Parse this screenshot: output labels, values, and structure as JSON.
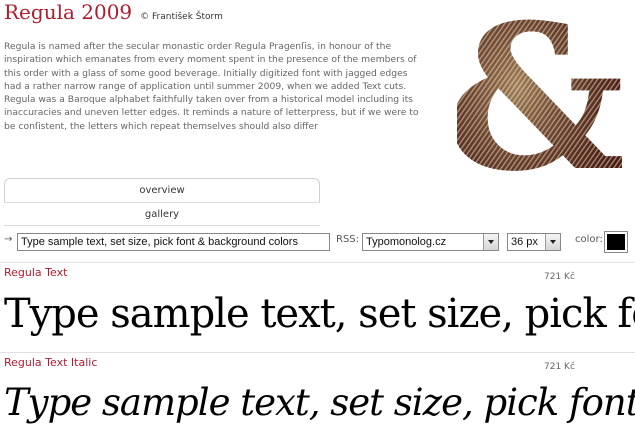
{
  "header": {
    "font_name": "Regula 2009",
    "designer": "© František Štorm"
  },
  "description": "Regula is named after the secular monastic order Regula Pragenſis, in honour of the inspiration which emanates from every moment spent in the presence of the members of this order with a glass of some good beverage. Initially digitized font with jagged edges had a rather narrow range of application until summer 2009, when we added Text cuts. Regula was a Baroque alphabet faithfully taken over from a historical model including its inaccuracies and uneven letter edges. It reminds a nature of letterpress, but if we were to be conſistent, the letters which repeat themselves should also differ",
  "tabs": [
    {
      "label": "overview"
    },
    {
      "label": "gallery"
    }
  ],
  "controls": {
    "arrow": "→",
    "sample_text": "Type sample text, set size, pick font & background colors",
    "rss_label": "RSS:",
    "rss_value": "Typomonolog.cz",
    "size_value": "36 px",
    "color_label": "color:",
    "color_value": "#000000"
  },
  "specimens": [
    {
      "name": "Regula Text",
      "price": "721 Kč",
      "sample": "Type sample text, set size, pick font & background colors"
    },
    {
      "name": "Regula Text Italic",
      "price": "721 Kč",
      "sample": "Type sample text, set size, pick font & background colors"
    }
  ],
  "colors": {
    "accent": "#b01c2e",
    "ampersand_dark": "#4a1a1e",
    "ampersand_light": "#c7ad7a"
  }
}
